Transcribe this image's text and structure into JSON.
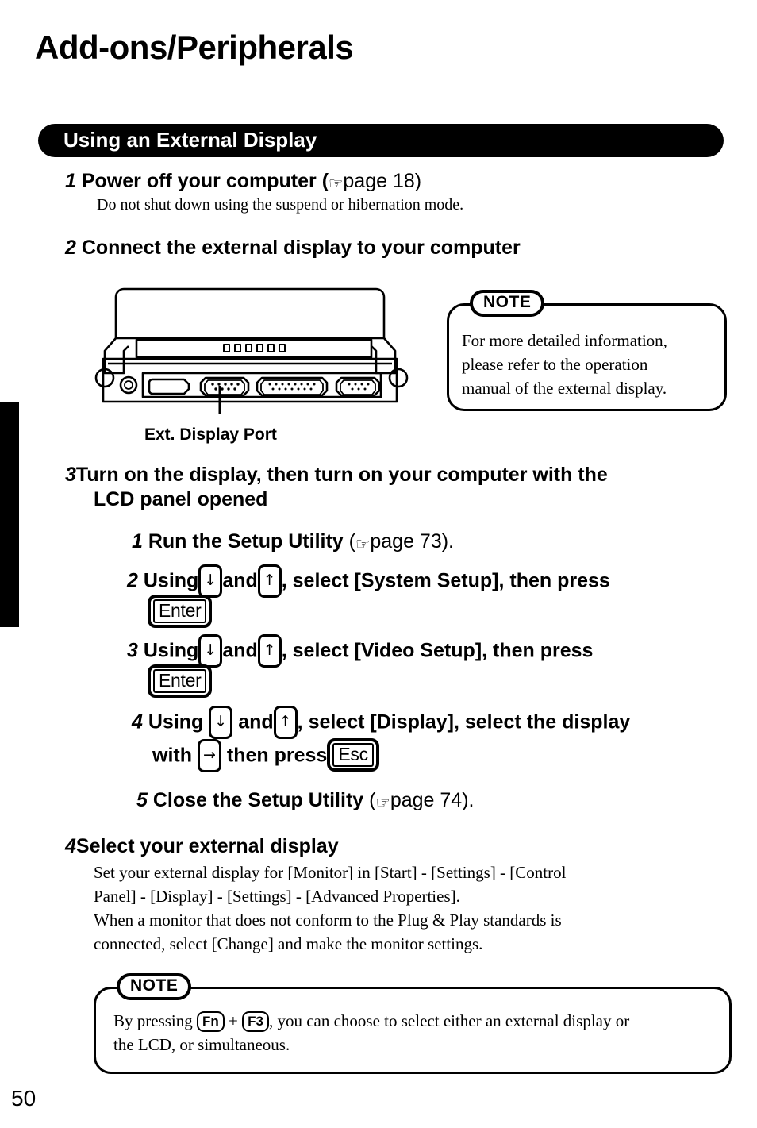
{
  "page": {
    "title": "Add-ons/Peripherals",
    "number": "50",
    "edge_tab": true,
    "accent_color": "#000000",
    "background_color": "#ffffff"
  },
  "section": {
    "banner_label": "Using an External Display"
  },
  "icons": {
    "pointing_hand": "☞"
  },
  "steps": [
    {
      "number": "1",
      "heading": "Power off your computer",
      "ref_prefix": "(",
      "ref_text": "page 18)",
      "body": "Do not shut down using the suspend or hibernation mode."
    },
    {
      "number": "2",
      "heading": "Connect the external display to your computer"
    },
    {
      "number": "3",
      "heading_line1": "Turn on the display, then turn on your computer with the",
      "heading_line2": "LCD panel opened"
    },
    {
      "number": "4",
      "heading": "Select your external display",
      "body_line1": "Set your external display for  [Monitor] in [Start] - [Settings] - [Control",
      "body_line2": "Panel] - [Display] - [Settings] - [Advanced Properties].",
      "body_line3": "When a monitor that does not conform to the Plug & Play standards is",
      "body_line4": "connected, select [Change] and make the monitor settings."
    }
  ],
  "substeps": [
    {
      "number": "1",
      "text_before": "Run the Setup Utility",
      "ref_prefix": "(",
      "ref_text": "page 73)."
    },
    {
      "number": "2",
      "t1": "Using",
      "key1": "↓",
      "t2": "and",
      "key2": "↑",
      "t3": ", select [System Setup], then press",
      "key3": "Enter"
    },
    {
      "number": "3",
      "t1": "Using",
      "key1": "↓",
      "t2": "and",
      "key2": "↑",
      "t3": ", select [Video Setup], then press",
      "key3": "Enter"
    },
    {
      "number": "4",
      "t1": "Using",
      "key1": "↓",
      "t2": "and",
      "key2": "↑",
      "t3": ", select [Display], select the display",
      "t4": "with",
      "key4": "→",
      "t5": "then press",
      "key5": "Esc"
    },
    {
      "number": "5",
      "text_before": "Close the Setup Utility",
      "ref_prefix": "(",
      "ref_text": "page 74)."
    }
  ],
  "diagram": {
    "caption": "Ext. Display Port",
    "description": "rear view of notebook computer showing connector ports"
  },
  "notes": [
    {
      "label": "NOTE",
      "line1": "For more detailed information,",
      "line2": "please refer to the operation",
      "line3": "manual of the external display."
    },
    {
      "label": "NOTE",
      "text_a": "By pressing",
      "key1": "Fn",
      "plus": "+",
      "key2": "F3",
      "text_b": ", you can choose to select either an external display or",
      "line2": "the LCD, or simultaneous."
    }
  ]
}
